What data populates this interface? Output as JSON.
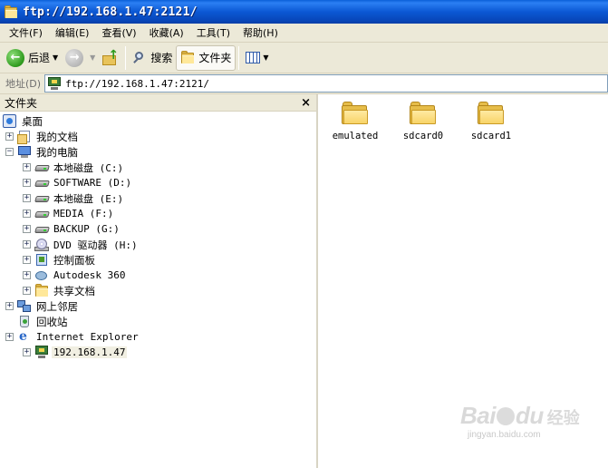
{
  "window": {
    "title": "ftp://192.168.1.47:2121/"
  },
  "menu": [
    {
      "label": "文件(F)"
    },
    {
      "label": "编辑(E)"
    },
    {
      "label": "查看(V)"
    },
    {
      "label": "收藏(A)"
    },
    {
      "label": "工具(T)"
    },
    {
      "label": "帮助(H)"
    }
  ],
  "toolbar": {
    "back_label": "后退",
    "search_label": "搜索",
    "folders_label": "文件夹"
  },
  "address": {
    "label": "地址(D)",
    "value": "ftp://192.168.1.47:2121/"
  },
  "folder_pane": {
    "title": "文件夹",
    "close": "×",
    "tree": [
      {
        "label": "桌面",
        "icon": "desktop-icon"
      },
      {
        "label": "我的文档",
        "icon": "my-documents-icon"
      },
      {
        "label": "我的电脑",
        "icon": "my-computer-icon"
      },
      {
        "label": "本地磁盘 (C:)",
        "icon": "hard-drive-icon"
      },
      {
        "label": "SOFTWARE (D:)",
        "icon": "hard-drive-icon"
      },
      {
        "label": "本地磁盘 (E:)",
        "icon": "hard-drive-icon"
      },
      {
        "label": "MEDIA (F:)",
        "icon": "hard-drive-icon"
      },
      {
        "label": "BACKUP (G:)",
        "icon": "hard-drive-icon"
      },
      {
        "label": "DVD 驱动器 (H:)",
        "icon": "dvd-drive-icon"
      },
      {
        "label": "控制面板",
        "icon": "control-panel-icon"
      },
      {
        "label": "Autodesk 360",
        "icon": "autodesk-icon"
      },
      {
        "label": "共享文档",
        "icon": "folder-icon"
      },
      {
        "label": "网上邻居",
        "icon": "network-icon"
      },
      {
        "label": "回收站",
        "icon": "recycle-bin-icon"
      },
      {
        "label": "Internet Explorer",
        "icon": "internet-explorer-icon"
      },
      {
        "label": "192.168.1.47",
        "icon": "ftp-site-icon"
      }
    ]
  },
  "content": {
    "folders": [
      {
        "label": "emulated"
      },
      {
        "label": "sdcard0"
      },
      {
        "label": "sdcard1"
      }
    ]
  },
  "watermark": {
    "logo": "Bai",
    "logo2": "du",
    "cn": "经验",
    "url": "jingyan.baidu.com"
  },
  "colors": {
    "titlebar": "#0b58d4",
    "chrome": "#ece9d8",
    "address_border": "#7f9db9"
  }
}
